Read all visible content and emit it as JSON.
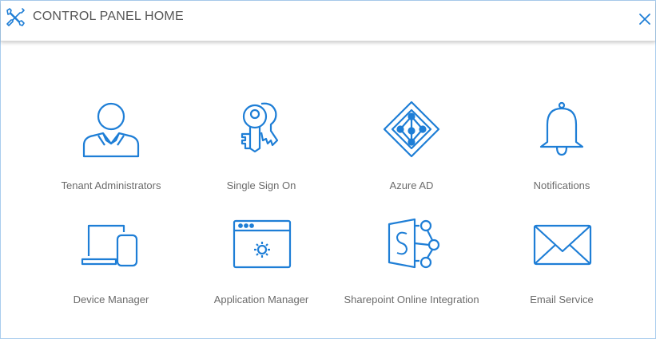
{
  "header": {
    "title": "CONTROL PANEL HOME",
    "tools_icon": "tools-icon",
    "close_icon": "close-icon"
  },
  "colors": {
    "accent": "#1e7ed6",
    "label": "#6b6b6b",
    "title": "#555555",
    "border": "#a9cdee"
  },
  "tiles": [
    {
      "label": "Tenant Administrators",
      "icon": "user-admin-icon"
    },
    {
      "label": "Single Sign On",
      "icon": "keys-icon"
    },
    {
      "label": "Azure AD",
      "icon": "azure-ad-icon"
    },
    {
      "label": "Notifications",
      "icon": "bell-icon"
    },
    {
      "label": "Device Manager",
      "icon": "devices-icon"
    },
    {
      "label": "Application Manager",
      "icon": "app-window-gear-icon"
    },
    {
      "label": "Sharepoint Online Integration",
      "icon": "sharepoint-icon"
    },
    {
      "label": "Email Service",
      "icon": "envelope-icon"
    }
  ]
}
